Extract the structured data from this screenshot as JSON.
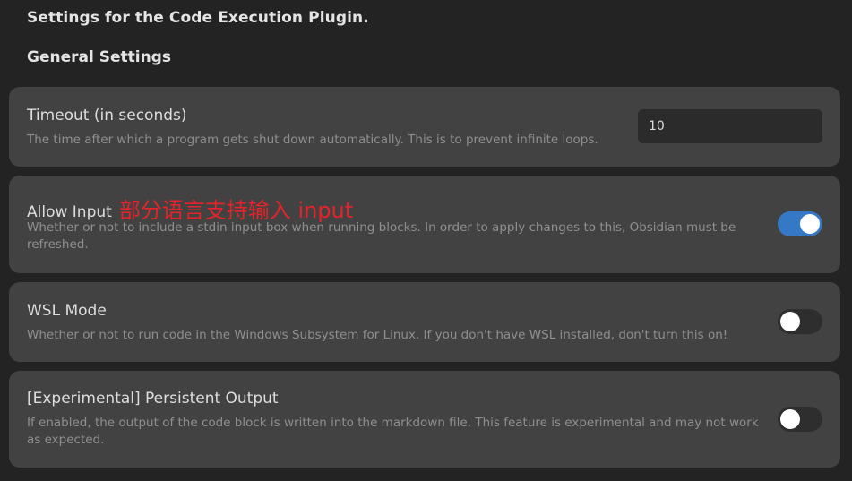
{
  "header": {
    "title": "Settings for the Code Execution Plugin.",
    "section": "General Settings"
  },
  "settings": [
    {
      "name": "Timeout (in seconds)",
      "description": "The time after which a program gets shut down automatically. This is to prevent infinite loops.",
      "control": "text",
      "value": "10"
    },
    {
      "name": "Allow Input",
      "annotation": "部分语言支持输入 input",
      "description": "Whether or not to include a stdin input box when running blocks. In order to apply changes to this, Obsidian must be refreshed.",
      "control": "toggle",
      "enabled": true
    },
    {
      "name": "WSL Mode",
      "description": "Whether or not to run code in the Windows Subsystem for Linux. If you don't have WSL installed, don't turn this on!",
      "control": "toggle",
      "enabled": false
    },
    {
      "name": "[Experimental] Persistent Output",
      "description": "If enabled, the output of the code block is written into the markdown file. This feature is experimental and may not work as expected.",
      "control": "toggle",
      "enabled": false
    }
  ],
  "colors": {
    "background": "#232323",
    "card": "#424242",
    "accent": "#3478c6",
    "annotation": "#e5232a"
  }
}
